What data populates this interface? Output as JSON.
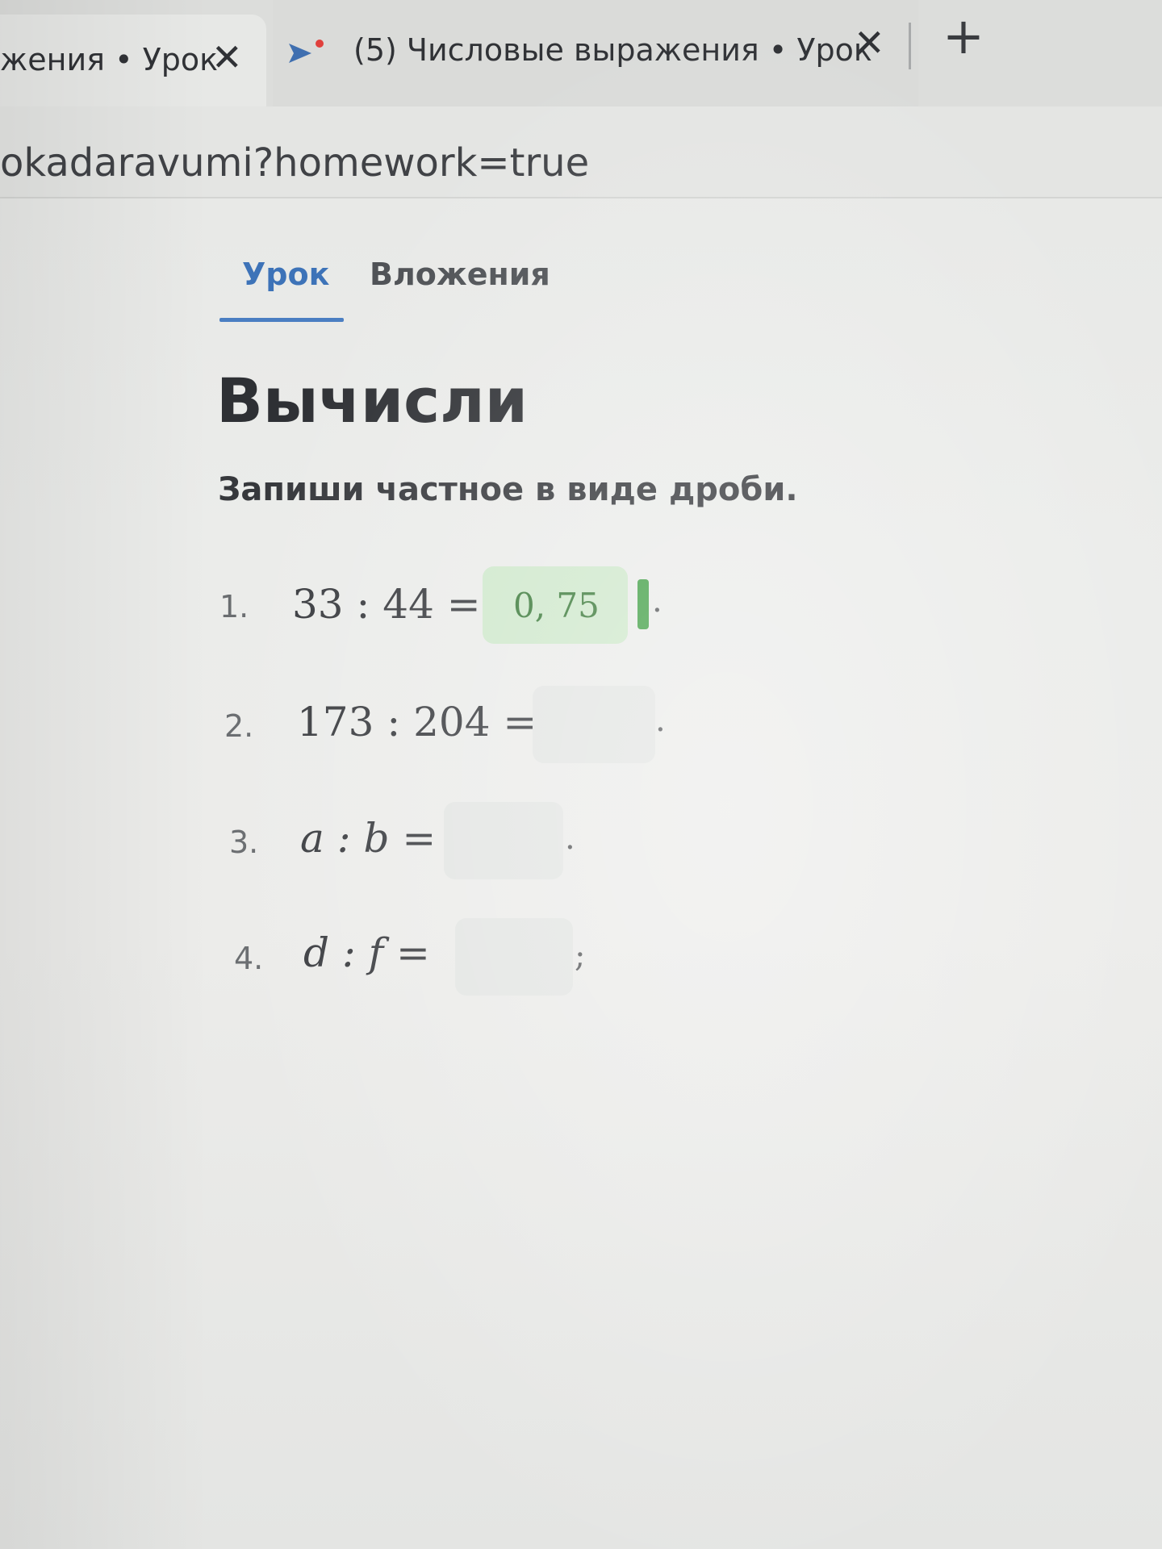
{
  "browser": {
    "tabs": [
      {
        "title": "жения • Урок"
      },
      {
        "title": "(5) Числовые выражения • Урок"
      }
    ],
    "url": "okadaravumi?homework=true"
  },
  "icons": {
    "close": "close-icon",
    "new_tab": "plus-icon",
    "favicon": "site-favicon-icon"
  },
  "page": {
    "tabs": [
      {
        "label": "Урок",
        "active": true
      },
      {
        "label": "Вложения",
        "active": false
      }
    ],
    "heading": "Вычисли",
    "instruction": "Запиши частное в виде дроби.",
    "tasks": [
      {
        "number": "1.",
        "expression": "33 : 44 =",
        "answer": "0, 75",
        "end": "."
      },
      {
        "number": "2.",
        "expression": "173 : 204 =",
        "answer": "",
        "end": "."
      },
      {
        "number": "3.",
        "expression": "a : b =",
        "answer": "",
        "end": "."
      },
      {
        "number": "4.",
        "expression": "d : f =",
        "answer": "",
        "end": ";"
      }
    ]
  },
  "colors": {
    "active_tab": "#3d73b8",
    "filled_answer_bg": "#cfe8cc",
    "filled_answer_text": "#3b7a3a",
    "cursor": "#43a047"
  }
}
